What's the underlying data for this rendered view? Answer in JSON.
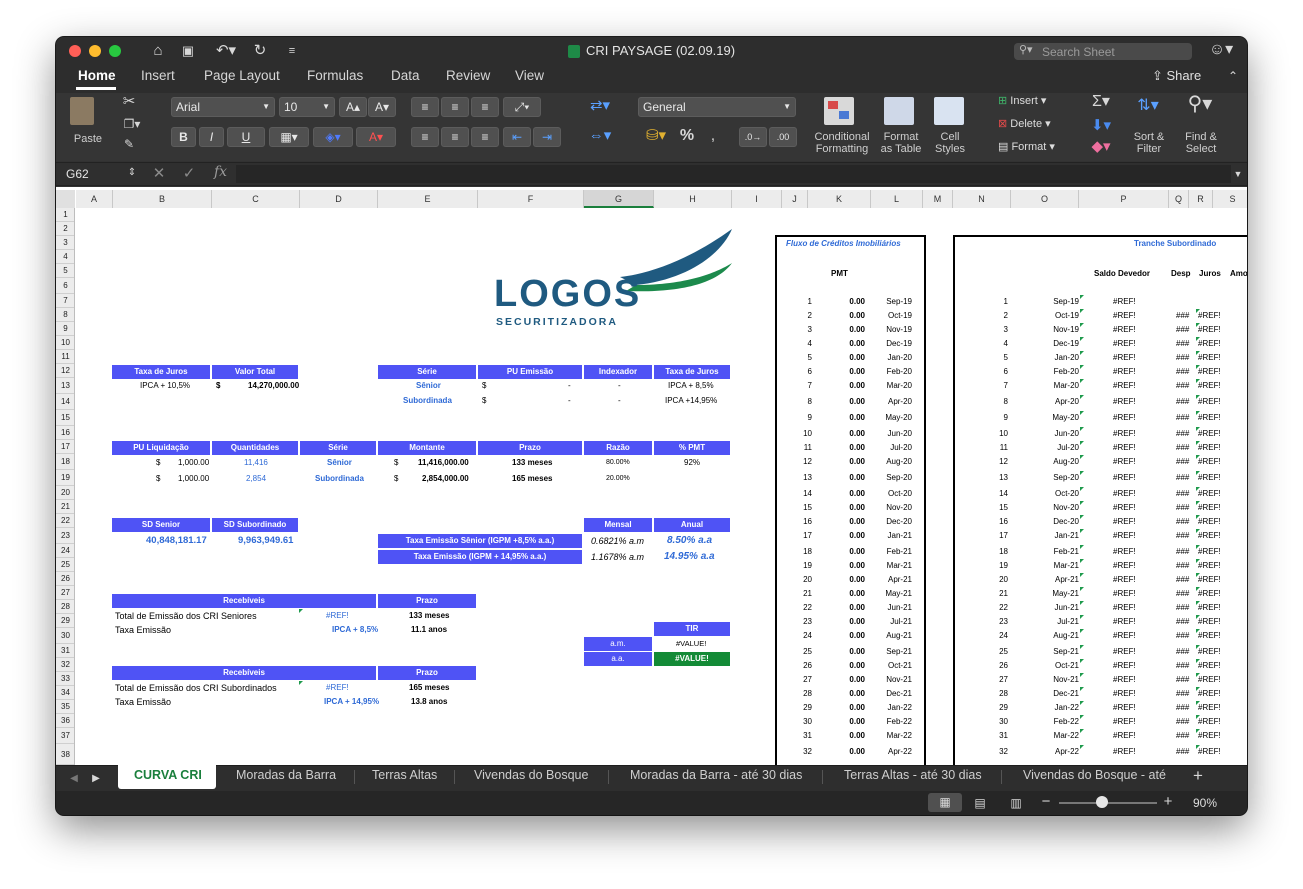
{
  "window_title": "CRI PAYSAGE (02.09.19)",
  "search_placeholder": "Search Sheet",
  "share_label": "Share",
  "tabs": [
    "Home",
    "Insert",
    "Page Layout",
    "Formulas",
    "Data",
    "Review",
    "View"
  ],
  "ribbon": {
    "paste": "Paste",
    "font": "Arial",
    "size": "10",
    "number_format": "General",
    "conditional": [
      "Conditional",
      "Formatting"
    ],
    "format_table": [
      "Format",
      "as Table"
    ],
    "cell_styles": [
      "Cell",
      "Styles"
    ],
    "insert": "Insert",
    "delete": "Delete",
    "format": "Format",
    "sort_filter": [
      "Sort &",
      "Filter"
    ],
    "find_select": [
      "Find &",
      "Select"
    ],
    "bold": "B",
    "italic": "I",
    "underline": "U",
    "percent": "%"
  },
  "formula_bar": {
    "name_box": "G62",
    "fx": "fx",
    "content": ""
  },
  "columns": [
    "A",
    "B",
    "C",
    "D",
    "E",
    "F",
    "G",
    "H",
    "I",
    "J",
    "K",
    "L",
    "M",
    "N",
    "O",
    "P",
    "Q",
    "R",
    "S"
  ],
  "rows": [
    "1",
    "2",
    "3",
    "4",
    "5",
    "6",
    "7",
    "8",
    "9",
    "10",
    "11",
    "12",
    "13",
    "14",
    "15",
    "16",
    "17",
    "18",
    "19",
    "20",
    "21",
    "22",
    "23",
    "24",
    "25",
    "26",
    "27",
    "28",
    "29",
    "30",
    "31",
    "32",
    "33",
    "34",
    "35",
    "36",
    "37",
    "38"
  ],
  "logo": {
    "name": "LOGOS",
    "sub": "SECURITIZADORA"
  },
  "block1": {
    "headers": [
      "Taxa de Juros",
      "Valor Total"
    ],
    "taxa": "IPCA + 10,5%",
    "currency": "$",
    "valor": "14,270,000.00"
  },
  "block2": {
    "headers": [
      "Série",
      "PU Emissão",
      "Indexador",
      "Taxa de Juros"
    ],
    "rows": [
      {
        "serie": "Sênior",
        "cur": "$",
        "pu": "-",
        "idx": "-",
        "taxa": "IPCA + 8,5%"
      },
      {
        "serie": "Subordinada",
        "cur": "$",
        "pu": "-",
        "idx": "-",
        "taxa": "IPCA +14,95%"
      }
    ]
  },
  "block3": {
    "headers": [
      "PU Liquidação",
      "Quantidades",
      "Série",
      "Montante",
      "Prazo",
      "Razão",
      "% PMT"
    ],
    "rows": [
      {
        "cur": "$",
        "pu": "1,000.00",
        "qtd": "11,416",
        "serie": "Sênior",
        "cur2": "$",
        "mont": "11,416,000.00",
        "prazo": "133 meses",
        "razao": "80.00%",
        "pmt": "92%"
      },
      {
        "cur": "$",
        "pu": "1,000.00",
        "qtd": "2,854",
        "serie": "Subordinada",
        "cur2": "$",
        "mont": "2,854,000.00",
        "prazo": "165 meses",
        "razao": "20.00%",
        "pmt": ""
      }
    ]
  },
  "block4": {
    "headers": [
      "SD Senior",
      "SD Subordinado"
    ],
    "values": [
      "40,848,181.17",
      "9,963,949.61"
    ],
    "rate_headers": [
      "Mensal",
      "Anual"
    ],
    "rates": [
      {
        "label": "Taxa Emissão Sênior (IGPM +8,5% a.a.)",
        "mensal": "0.6821% a.m",
        "anual": "8.50% a.a"
      },
      {
        "label": "Taxa Emissão (IGPM + 14,95% a.a.)",
        "mensal": "1.1678% a.m",
        "anual": "14.95% a.a"
      }
    ]
  },
  "block5": {
    "header": "Recebíveis",
    "prazo_header": "Prazo",
    "rows": [
      {
        "label": "Total de Emissão dos CRI Seniores",
        "val": "#REF!",
        "prazo": "133 meses"
      },
      {
        "label": "Taxa Emissão",
        "val": "IPCA + 8,5%",
        "prazo": "11.1 anos"
      }
    ]
  },
  "tir": {
    "header": "TIR",
    "am_label": "a.m.",
    "aa_label": "a.a.",
    "am": "#VALUE!",
    "aa": "#VALUE!"
  },
  "block6": {
    "header": "Recebíveis",
    "prazo_header": "Prazo",
    "rows": [
      {
        "label": "Total de Emissão dos CRI Subordinados",
        "val": "#REF!",
        "prazo": "165 meses"
      },
      {
        "label": "Taxa Emissão",
        "val": "IPCA + 14,95%",
        "prazo": "13.8 anos"
      }
    ]
  },
  "fluxo": {
    "title": "Fluxo de Créditos Imobiliários",
    "pmt": "PMT",
    "rows": [
      {
        "n": "1",
        "v": "0.00",
        "d": "Sep-19"
      },
      {
        "n": "2",
        "v": "0.00",
        "d": "Oct-19"
      },
      {
        "n": "3",
        "v": "0.00",
        "d": "Nov-19"
      },
      {
        "n": "4",
        "v": "0.00",
        "d": "Dec-19"
      },
      {
        "n": "5",
        "v": "0.00",
        "d": "Jan-20"
      },
      {
        "n": "6",
        "v": "0.00",
        "d": "Feb-20"
      },
      {
        "n": "7",
        "v": "0.00",
        "d": "Mar-20"
      },
      {
        "n": "8",
        "v": "0.00",
        "d": "Apr-20"
      },
      {
        "n": "9",
        "v": "0.00",
        "d": "May-20"
      },
      {
        "n": "10",
        "v": "0.00",
        "d": "Jun-20"
      },
      {
        "n": "11",
        "v": "0.00",
        "d": "Jul-20"
      },
      {
        "n": "12",
        "v": "0.00",
        "d": "Aug-20"
      },
      {
        "n": "13",
        "v": "0.00",
        "d": "Sep-20"
      },
      {
        "n": "14",
        "v": "0.00",
        "d": "Oct-20"
      },
      {
        "n": "15",
        "v": "0.00",
        "d": "Nov-20"
      },
      {
        "n": "16",
        "v": "0.00",
        "d": "Dec-20"
      },
      {
        "n": "17",
        "v": "0.00",
        "d": "Jan-21"
      },
      {
        "n": "18",
        "v": "0.00",
        "d": "Feb-21"
      },
      {
        "n": "19",
        "v": "0.00",
        "d": "Mar-21"
      },
      {
        "n": "20",
        "v": "0.00",
        "d": "Apr-21"
      },
      {
        "n": "21",
        "v": "0.00",
        "d": "May-21"
      },
      {
        "n": "22",
        "v": "0.00",
        "d": "Jun-21"
      },
      {
        "n": "23",
        "v": "0.00",
        "d": "Jul-21"
      },
      {
        "n": "24",
        "v": "0.00",
        "d": "Aug-21"
      },
      {
        "n": "25",
        "v": "0.00",
        "d": "Sep-21"
      },
      {
        "n": "26",
        "v": "0.00",
        "d": "Oct-21"
      },
      {
        "n": "27",
        "v": "0.00",
        "d": "Nov-21"
      },
      {
        "n": "28",
        "v": "0.00",
        "d": "Dec-21"
      },
      {
        "n": "29",
        "v": "0.00",
        "d": "Jan-22"
      },
      {
        "n": "30",
        "v": "0.00",
        "d": "Feb-22"
      },
      {
        "n": "31",
        "v": "0.00",
        "d": "Mar-22"
      },
      {
        "n": "32",
        "v": "0.00",
        "d": "Apr-22"
      }
    ]
  },
  "tranche": {
    "title": "Tranche Subordinado",
    "headers": [
      "Saldo Devedor",
      "Desp",
      "Juros",
      "Amo"
    ],
    "ref": "#REF!",
    "hash": "###"
  },
  "sheet_tabs": [
    "CURVA CRI",
    "Moradas da Barra",
    "Terras Altas",
    "Vivendas do Bosque",
    "Moradas da Barra - até 30 dias",
    "Terras Altas - até 30 dias",
    "Vivendas do Bosque - até"
  ],
  "zoom": "90%",
  "colors": {
    "header_fill": "#4f53f5",
    "blue_text": "#2f6ad6",
    "tir_green": "#138a36",
    "logo_navy": "#1f5a80"
  }
}
